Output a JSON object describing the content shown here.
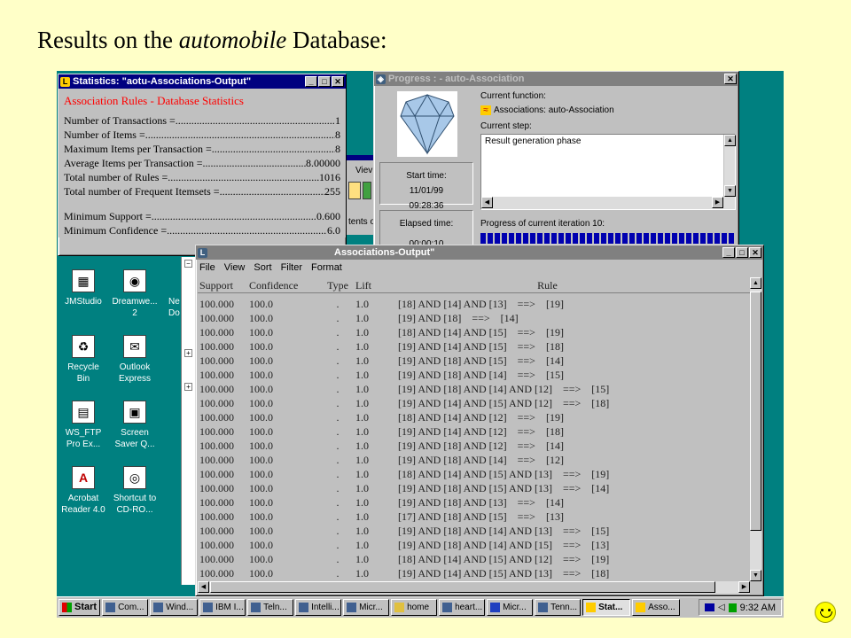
{
  "slide": {
    "title_pre": "Results on the ",
    "title_italic": "automobile",
    "title_post": " Database:"
  },
  "stats_window": {
    "title": "Statistics:  \"aotu-Associations-Output\"",
    "header": "Association Rules - Database Statistics",
    "rows": [
      {
        "label": "Number of Transactions =",
        "value": "1"
      },
      {
        "label": "Number of Items =",
        "value": "8"
      },
      {
        "label": "Maximum Items per Transaction =",
        "value": "8"
      },
      {
        "label": "Average Items per Transaction =",
        "value": "8.00000"
      },
      {
        "label": "Total number of Rules =",
        "value": "1016"
      },
      {
        "label": "Total number of Frequent Itemsets =",
        "value": "255"
      }
    ],
    "rows2": [
      {
        "label": "Minimum Support =",
        "value": "0.600"
      },
      {
        "label": "Minimum Confidence =",
        "value": "6.0"
      }
    ]
  },
  "progress_window": {
    "title": "Progress : - auto-Association",
    "current_function_label": "Current function:",
    "current_function_value": "Associations: auto-Association",
    "current_step_label": "Current step:",
    "current_step_value": "Result generation phase",
    "start_time_label": "Start time:",
    "start_date": "11/01/99",
    "start_time": "09:28:36",
    "elapsed_label": "Elapsed time:",
    "elapsed_value": "00:00:10",
    "iteration_label": "Progress of current iteration 10:"
  },
  "rules_window": {
    "title": "Associations-Output\"",
    "menu": [
      "File",
      "View",
      "Sort",
      "Filter",
      "Format"
    ],
    "columns": [
      "Support",
      "Confidence",
      "Type",
      "Lift",
      "Rule"
    ],
    "rows": [
      [
        "100.000",
        "100.0",
        ".",
        "1.0",
        "[18] AND [14] AND [13]    ==>    [19]"
      ],
      [
        "100.000",
        "100.0",
        ".",
        "1.0",
        "[19] AND [18]    ==>    [14]"
      ],
      [
        "100.000",
        "100.0",
        ".",
        "1.0",
        "[18] AND [14] AND [15]    ==>    [19]"
      ],
      [
        "100.000",
        "100.0",
        ".",
        "1.0",
        "[19] AND [14] AND [15]    ==>    [18]"
      ],
      [
        "100.000",
        "100.0",
        ".",
        "1.0",
        "[19] AND [18] AND [15]    ==>    [14]"
      ],
      [
        "100.000",
        "100.0",
        ".",
        "1.0",
        "[19] AND [18] AND [14]    ==>    [15]"
      ],
      [
        "100.000",
        "100.0",
        ".",
        "1.0",
        "[19] AND [18] AND [14] AND [12]    ==>    [15]"
      ],
      [
        "100.000",
        "100.0",
        ".",
        "1.0",
        "[19] AND [14] AND [15] AND [12]    ==>    [18]"
      ],
      [
        "100.000",
        "100.0",
        ".",
        "1.0",
        "[18] AND [14] AND [12]    ==>    [19]"
      ],
      [
        "100.000",
        "100.0",
        ".",
        "1.0",
        "[19] AND [14] AND [12]    ==>    [18]"
      ],
      [
        "100.000",
        "100.0",
        ".",
        "1.0",
        "[19] AND [18] AND [12]    ==>    [14]"
      ],
      [
        "100.000",
        "100.0",
        ".",
        "1.0",
        "[19] AND [18] AND [14]    ==>    [12]"
      ],
      [
        "100.000",
        "100.0",
        ".",
        "1.0",
        "[18] AND [14] AND [15] AND [13]    ==>    [19]"
      ],
      [
        "100.000",
        "100.0",
        ".",
        "1.0",
        "[19] AND [18] AND [15] AND [13]    ==>    [14]"
      ],
      [
        "100.000",
        "100.0",
        ".",
        "1.0",
        "[19] AND [18] AND [13]    ==>    [14]"
      ],
      [
        "100.000",
        "100.0",
        ".",
        "1.0",
        "[17] AND [18] AND [15]    ==>    [13]"
      ],
      [
        "100.000",
        "100.0",
        ".",
        "1.0",
        "[19] AND [18] AND [14] AND [13]    ==>    [15]"
      ],
      [
        "100.000",
        "100.0",
        ".",
        "1.0",
        "[19] AND [18] AND [14] AND [15]    ==>    [13]"
      ],
      [
        "100.000",
        "100.0",
        ".",
        "1.0",
        "[18] AND [14] AND [15] AND [12]    ==>    [19]"
      ],
      [
        "100.000",
        "100.0",
        ".",
        "1.0",
        "[19] AND [14] AND [15] AND [13]    ==>    [18]"
      ]
    ]
  },
  "background_fragments": {
    "view_label": "Viev",
    "contents_label": "tents o",
    "ne_label": "Ne",
    "do_label": "Do"
  },
  "desktop_icons": [
    {
      "label": "JMStudio",
      "glyph": "▦"
    },
    {
      "label": "Dreamwe...\n2",
      "glyph": "◉"
    },
    {
      "label": "Recycle\nBin",
      "glyph": "♻"
    },
    {
      "label": "Outlook\nExpress",
      "glyph": "✉"
    },
    {
      "label": "WS_FTP\nPro Ex...",
      "glyph": "▤"
    },
    {
      "label": "Screen\nSaver Q...",
      "glyph": "▣"
    },
    {
      "label": "Acrobat\nReader 4.0",
      "glyph": "A"
    },
    {
      "label": "Shortcut to\nCD-RO...",
      "glyph": "◎"
    }
  ],
  "taskbar": {
    "start": "Start",
    "buttons": [
      "Com...",
      "Wind...",
      "IBM I...",
      "Teln...",
      "Intelli...",
      "Micr...",
      "home",
      "heart...",
      "Micr...",
      "Tenn...",
      "Stat...",
      "Asso..."
    ],
    "clock": "9:32 AM"
  },
  "colors": {
    "slide_bg": "#ffffc8",
    "desktop": "#008080",
    "title_active": "#000080",
    "stats_header": "#ff0000",
    "progress_fill": "#0000b0"
  }
}
